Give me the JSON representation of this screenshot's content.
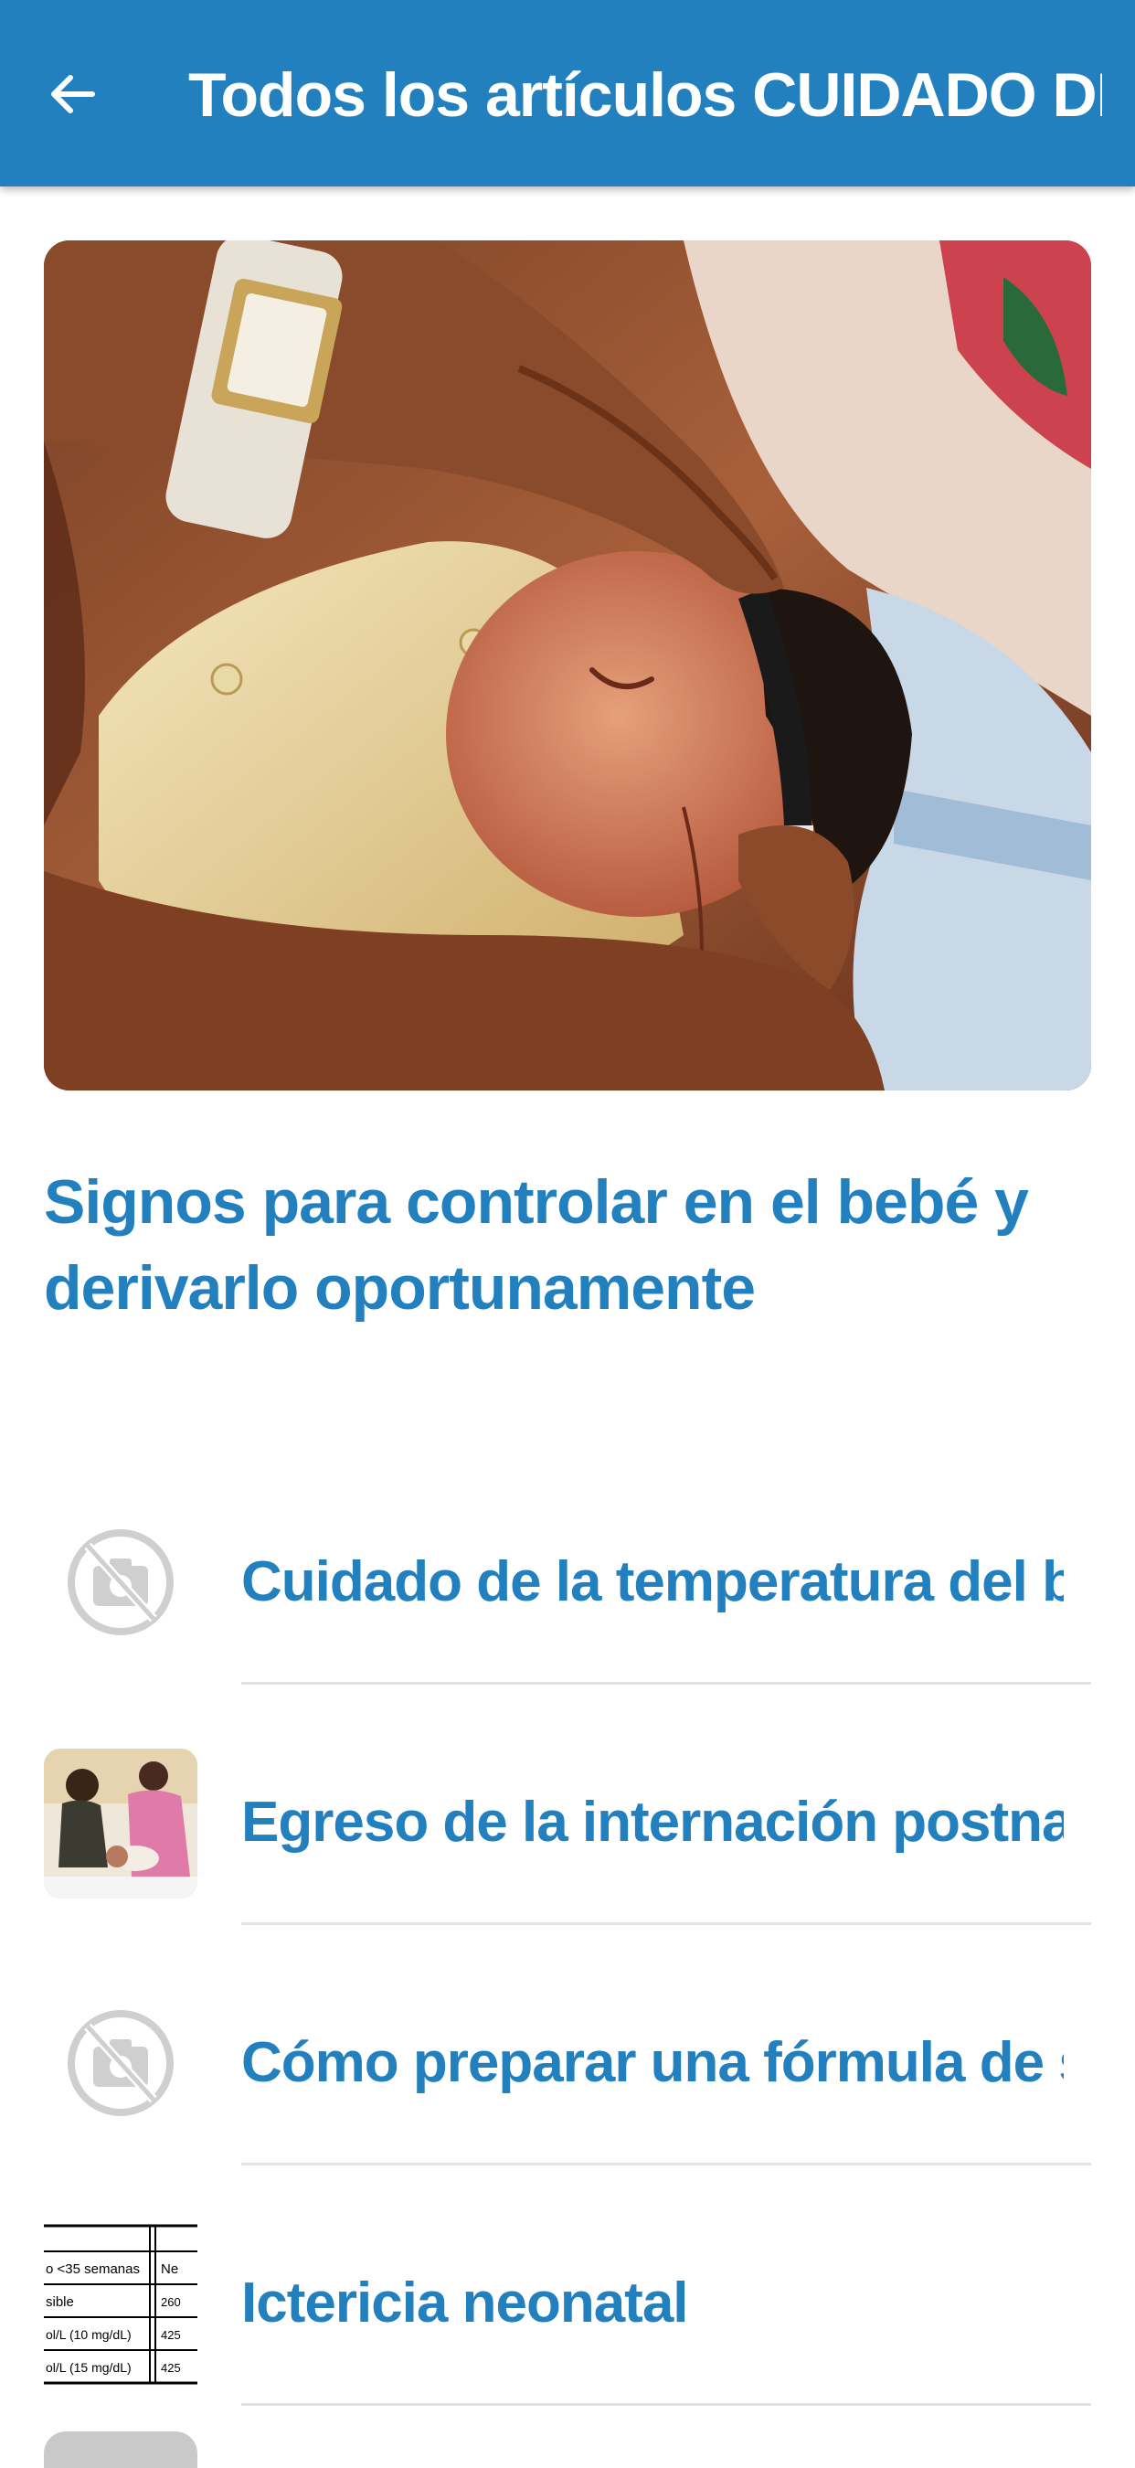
{
  "appbar": {
    "title": "Todos los artículos CUIDADO DEL …"
  },
  "featured": {
    "title": "Signos para controlar en el bebé y derivarlo oportunamente"
  },
  "articles": [
    {
      "title": "Cuidado de la temperatura del bebé…",
      "thumbnail": "no-image-icon"
    },
    {
      "title": "Egreso de la internación postnatal y…",
      "thumbnail": "photo"
    },
    {
      "title": "Cómo preparar una fórmula de suc…",
      "thumbnail": "no-image-icon"
    },
    {
      "title": "Ictericia neonatal",
      "thumbnail": "table-image",
      "table": [
        [
          "o <35 semanas",
          "Ne"
        ],
        [
          "sible",
          "260"
        ],
        [
          "ol/L (10 mg/dL)",
          "425"
        ],
        [
          "ol/L (15 mg/dL)",
          "425"
        ]
      ]
    }
  ],
  "colors": {
    "primary": "#2380be",
    "divider": "#e2e2e2",
    "placeholder": "#cfcfcf"
  }
}
